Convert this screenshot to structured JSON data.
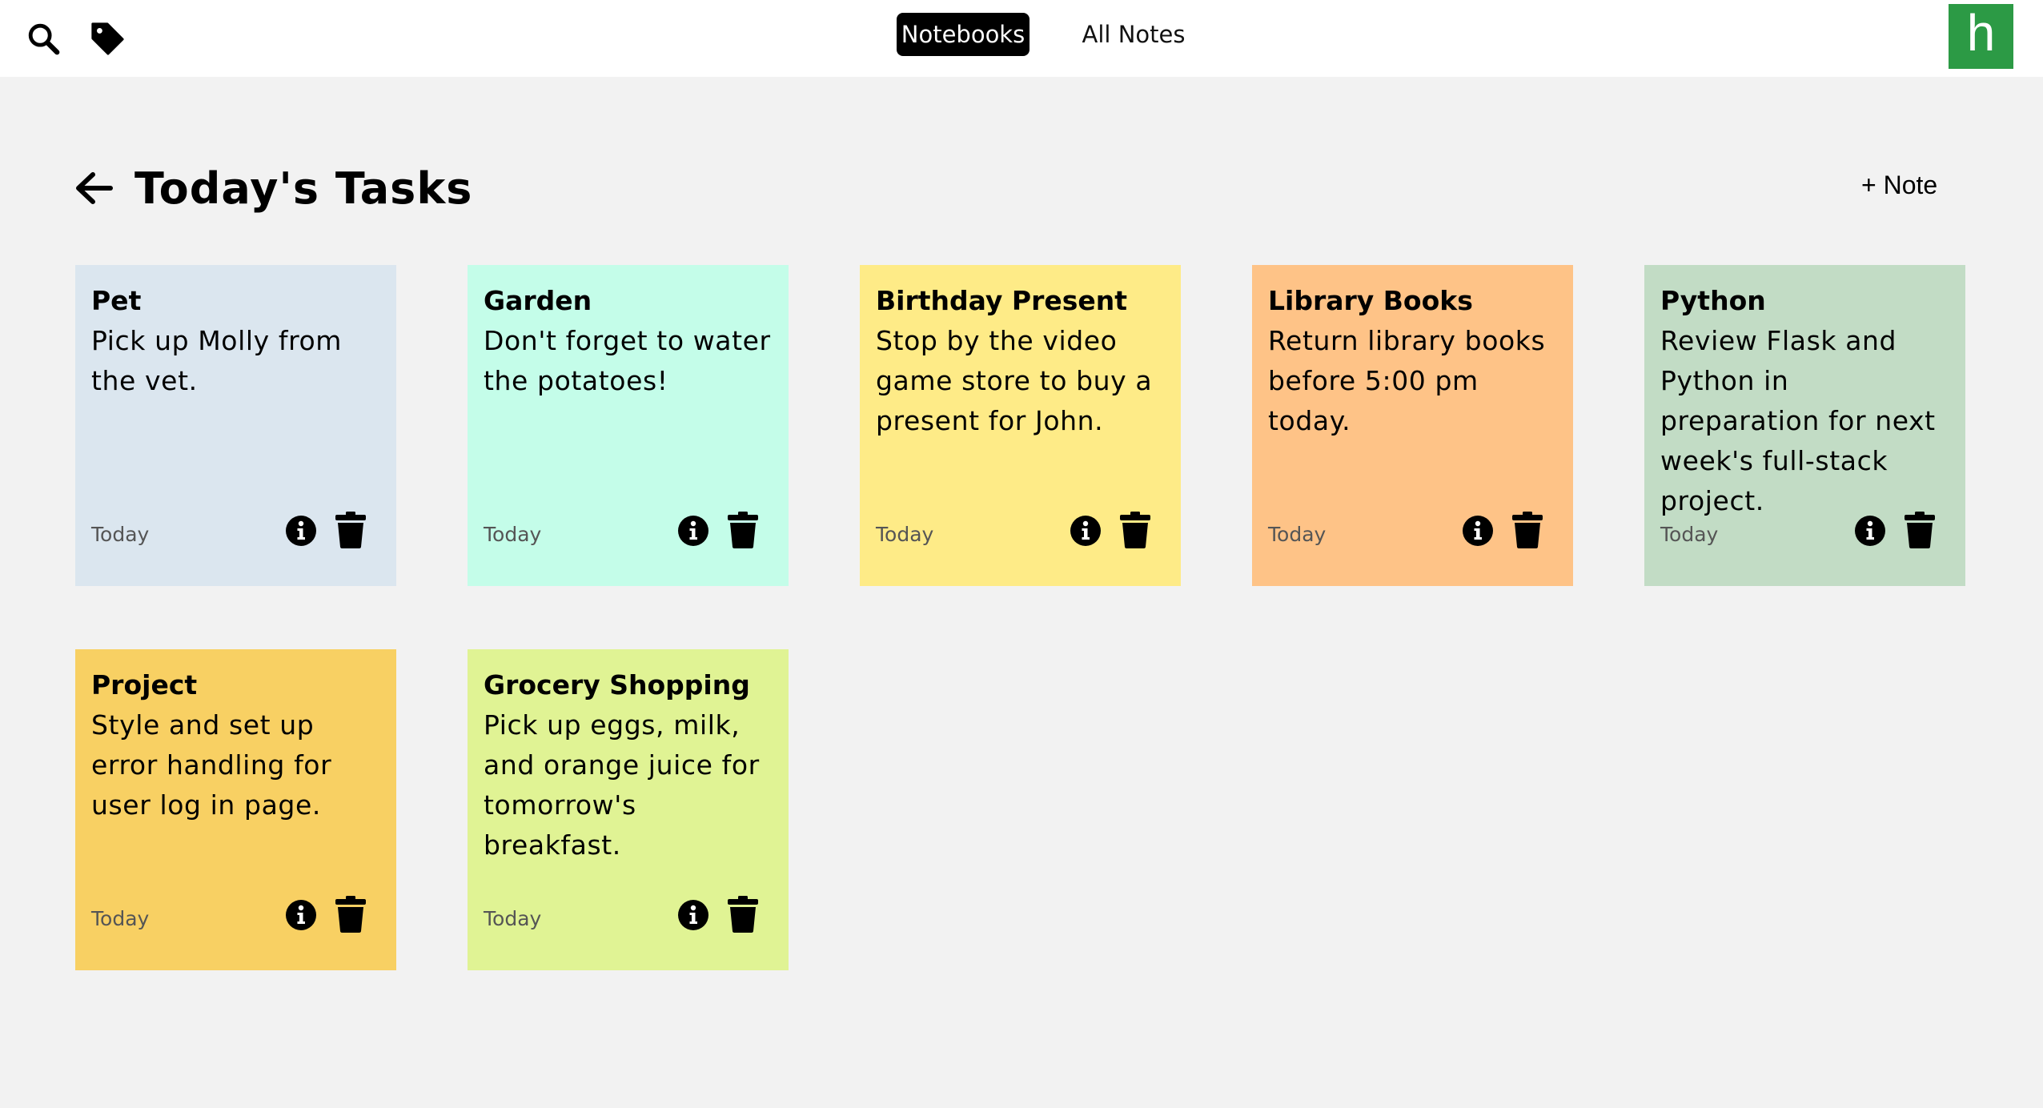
{
  "header": {
    "nav": [
      {
        "label": "Notebooks",
        "active": true
      },
      {
        "label": "All Notes",
        "active": false
      }
    ],
    "brand_letter": "h",
    "brand_color": "#2c9a45",
    "icons": [
      "search-icon",
      "tag-icon"
    ]
  },
  "page": {
    "title": "Today's Tasks",
    "add_note_label": "+ Note"
  },
  "notes": [
    {
      "title": "Pet",
      "body": "Pick up Molly from the vet.",
      "date": "Today",
      "color": "#dbe6ef"
    },
    {
      "title": "Garden",
      "body": "Don't forget to water the potatoes!",
      "date": "Today",
      "color": "#c4fde9"
    },
    {
      "title": "Birthday Present",
      "body": "Stop by the video game store to buy a present for John.",
      "date": "Today",
      "color": "#feeb87"
    },
    {
      "title": "Library Books",
      "body": "Return library books before 5:00 pm today.",
      "date": "Today",
      "color": "#fec387"
    },
    {
      "title": "Python",
      "body": "Review Flask and Python in preparation for next week's full-stack project.",
      "date": "Today",
      "color": "#c2dcc5"
    },
    {
      "title": "Project",
      "body": "Style and set up error handling for user log in page.",
      "date": "Today",
      "color": "#f8d063"
    },
    {
      "title": "Grocery Shopping",
      "body": "Pick up eggs, milk, and orange juice for tomorrow's breakfast.",
      "date": "Today",
      "color": "#e0f394"
    }
  ]
}
